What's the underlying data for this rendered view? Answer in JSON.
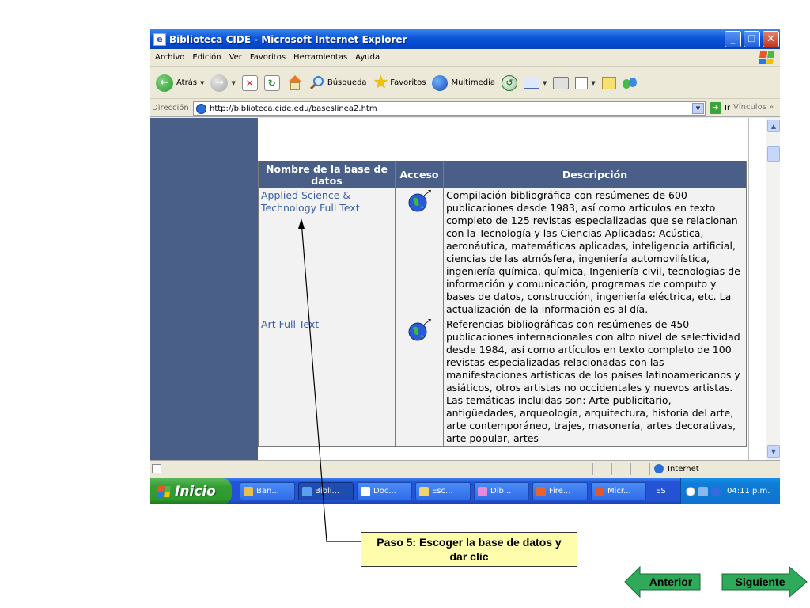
{
  "window": {
    "title": "Biblioteca CIDE - Microsoft Internet Explorer",
    "btn_min": "_",
    "btn_max": "❐",
    "btn_close": "✕"
  },
  "menu": [
    "Archivo",
    "Edición",
    "Ver",
    "Favoritos",
    "Herramientas",
    "Ayuda"
  ],
  "toolbar": {
    "back": "Atrás",
    "search": "Búsqueda",
    "favorites": "Favoritos",
    "multimedia": "Multimedia"
  },
  "address": {
    "label": "Dirección",
    "url": "http://biblioteca.cide.edu/baseslinea2.htm",
    "go": "Ir",
    "links": "Vínculos"
  },
  "table": {
    "headers": [
      "Nombre de la base de datos",
      "Acceso",
      "Descripción"
    ],
    "rows": [
      {
        "name": "Applied Science & Technology Full Text",
        "desc": "Compilación bibliográfica con resúmenes de 600 publicaciones desde 1983, así como  artículos en texto completo de 125 revistas especializadas que se relacionan con la Tecnología y las Ciencias Aplicadas: Acústica, aeronáutica, matemáticas aplicadas, inteligencia artificial, ciencias de las atmósfera, ingeniería automovilística, ingeniería química, química, Ingeniería civil, tecnologías de información y comunicación, programas de computo y bases de datos, construcción, ingeniería eléctrica, etc. La actualización de la información es al día."
      },
      {
        "name": "Art Full Text",
        "desc": "Referencias bibliográficas con resúmenes de 450 publicaciones internacionales con alto nivel de selectividad desde 1984, así como artículos en texto completo de 100 revistas especializadas relacionadas con las manifestaciones artísticas de los países latinoamericanos y asiáticos, otros artistas no occidentales y  nuevos artistas. Las temáticas incluidas son: Arte publicitario, antigüedades, arqueología, arquitectura, historia del arte, arte contemporáneo, trajes, masonería, artes decorativas, arte popular, artes"
      }
    ]
  },
  "status": {
    "zone": "Internet"
  },
  "taskbar": {
    "start": "Inicio",
    "items": [
      {
        "label": "Ban...",
        "color": "#e8c048"
      },
      {
        "label": "Bibli...",
        "color": "#5aa0f0",
        "active": true
      },
      {
        "label": "Doc...",
        "color": "#ffffff"
      },
      {
        "label": "Esc...",
        "color": "#f2d26a"
      },
      {
        "label": "Dib...",
        "color": "#e88ad8"
      },
      {
        "label": "Fire...",
        "color": "#e8642a"
      },
      {
        "label": "Micr...",
        "color": "#e0582a"
      }
    ],
    "lang": "ES",
    "clock": "04:11 p.m."
  },
  "callout": "Paso 5: Escoger la base de datos y dar clic",
  "nav": {
    "prev": "Anterior",
    "next": "Siguiente",
    "color": "#2eaa5a"
  }
}
